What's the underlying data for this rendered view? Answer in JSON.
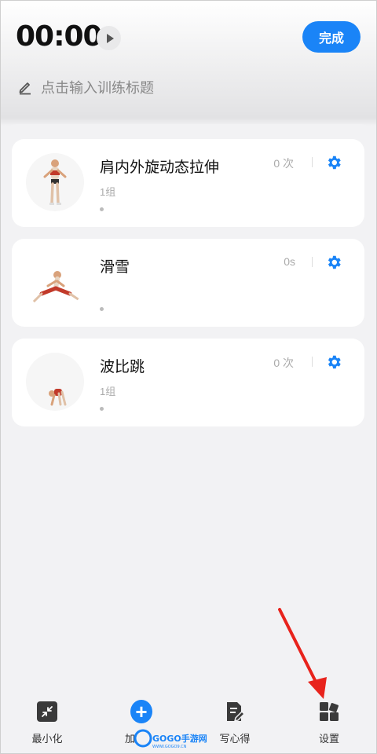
{
  "header": {
    "timer": "00:00",
    "done_label": "完成",
    "title_placeholder": "点击输入训练标题"
  },
  "exercises": [
    {
      "name": "肩内外旋动态拉伸",
      "sets": "1组",
      "count": "0 次"
    },
    {
      "name": "滑雪",
      "sets": "",
      "count": "0s"
    },
    {
      "name": "波比跳",
      "sets": "1组",
      "count": "0 次"
    }
  ],
  "bottom_bar": {
    "minimize_label": "最小化",
    "add_label": "加",
    "notes_label": "写心得",
    "settings_label": "设置"
  },
  "watermark": {
    "text": "GOGO手游网",
    "url": "WWW.GOGO9.CN"
  },
  "colors": {
    "accent": "#1a84f7",
    "annotation": "#e8231c"
  }
}
